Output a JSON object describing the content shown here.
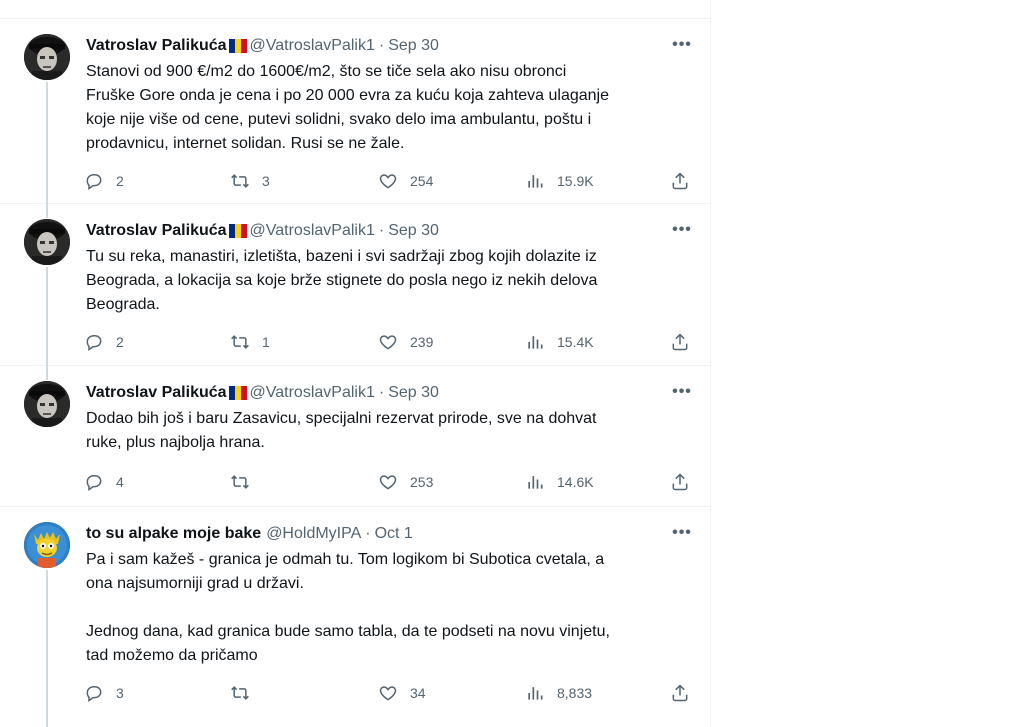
{
  "tweets": [
    {
      "name": "Vatroslav Palikuća",
      "handle": "@VatroslavPalik1",
      "date": "Sep 30",
      "text": "Stanovi od 900 €/m2 do 1600€/m2, što se tiče sela ako nisu obronci\nFruške Gore onda je cena i po 20 000 evra za kuću koja zahteva ulaganje\nkoje nije više od cene, putevi solidni, svako delo ima ambulantu, poštu i\nprodavnicu, internet solidan. Rusi se ne žale.",
      "replies": "2",
      "retweets": "3",
      "likes": "254",
      "views": "15.9K"
    },
    {
      "name": "Vatroslav Palikuća",
      "handle": "@VatroslavPalik1",
      "date": "Sep 30",
      "text": "Tu su reka, manastiri, izletišta, bazeni i svi sadržaji zbog kojih dolazite iz\nBeograda, a lokacija sa koje brže stignete do posla nego iz nekih delova\nBeograda.",
      "replies": "2",
      "retweets": "1",
      "likes": "239",
      "views": "15.4K"
    },
    {
      "name": "Vatroslav Palikuća",
      "handle": "@VatroslavPalik1",
      "date": "Sep 30",
      "text": "Dodao bih još i baru Zasavicu, specijalni rezervat prirode, sve na dohvat\nruke, plus najbolja hrana.",
      "replies": "4",
      "retweets": "",
      "likes": "253",
      "views": "14.6K"
    },
    {
      "name": "to su alpake moje bake",
      "handle": "@HoldMyIPA",
      "date": "Oct 1",
      "text": "Pa i sam kažeš - granica je odmah tu. Tom logikom bi Subotica cvetala, a\nona najsumorniji grad u državi.\n\nJednog dana, kad granica bude samo tabla, da te podseti na novu vinjetu,\ntad možemo da pričamo",
      "replies": "3",
      "retweets": "",
      "likes": "34",
      "views": "8,833"
    }
  ],
  "icons": {
    "reply": "reply-icon",
    "retweet": "retweet-icon",
    "like": "heart-icon",
    "views": "views-icon",
    "share": "share-icon",
    "more": "more-icon"
  },
  "flag_colors": [
    "#002b7f",
    "#fcd116",
    "#ce1126"
  ],
  "text_color": "#0f1419",
  "muted_color": "#536471"
}
